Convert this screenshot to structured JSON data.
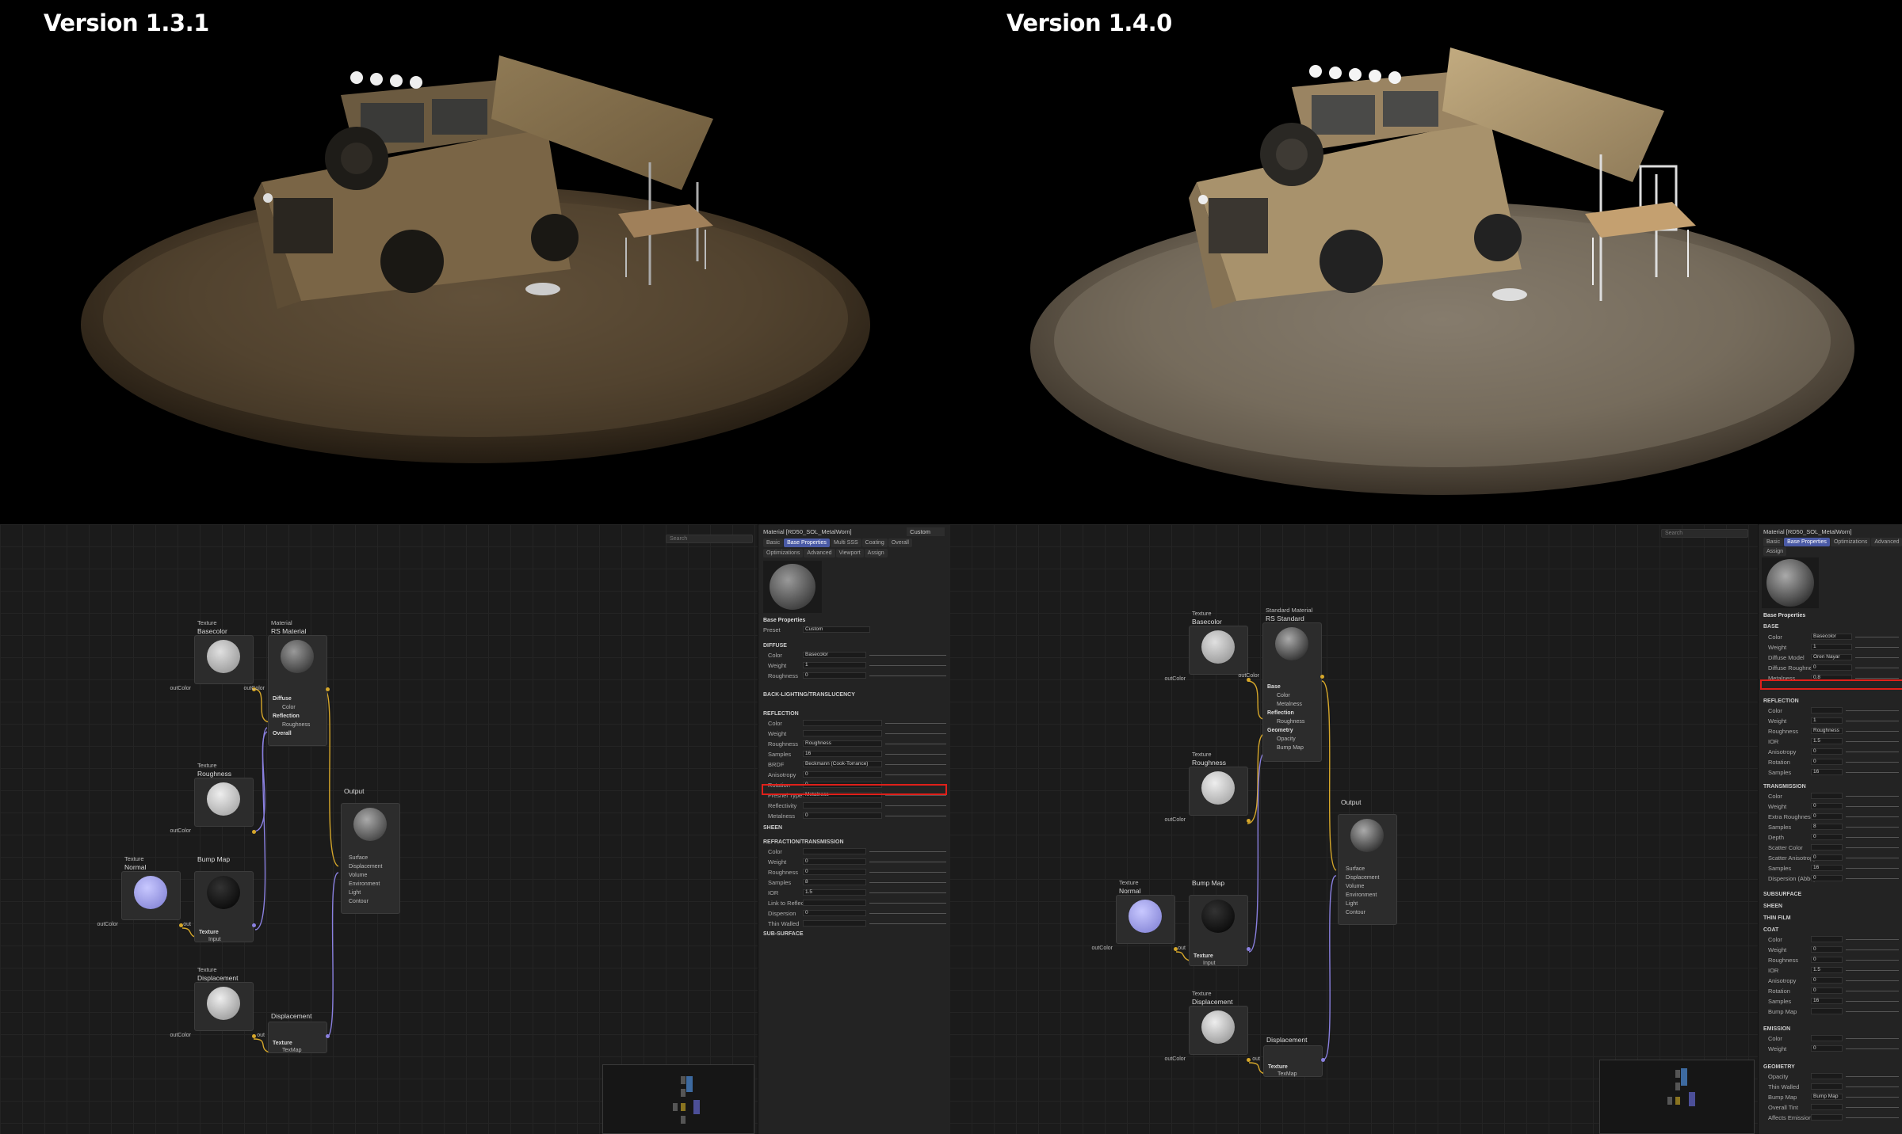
{
  "renders": {
    "left_title": "Version 1.3.1",
    "right_title": "Version 1.4.0"
  },
  "left_editor": {
    "search_placeholder": "Search",
    "nodes": {
      "basecolor": {
        "sup": "Texture",
        "title": "Basecolor",
        "out": "outColor"
      },
      "material": {
        "sup": "Material",
        "title": "RS Material",
        "out": "outColor",
        "inputs": [
          "Diffuse",
          "Color",
          "Reflection",
          "Roughness",
          "Overall"
        ]
      },
      "roughness": {
        "sup": "Texture",
        "title": "Roughness",
        "out": "outColor"
      },
      "output": {
        "title": "Output",
        "inputs": [
          "Surface",
          "Displacement",
          "Volume",
          "Environment",
          "Light",
          "Contour"
        ]
      },
      "normal": {
        "sup": "Texture",
        "title": "Normal",
        "out": "outColor"
      },
      "bumpmap": {
        "title": "Bump Map",
        "out": "out",
        "inputs": [
          "Texture",
          "Input"
        ]
      },
      "displacement_tex": {
        "sup": "Texture",
        "title": "Displacement",
        "out": "outColor"
      },
      "displacement": {
        "title": "Displacement",
        "out": "out",
        "inputs": [
          "Texture",
          "TexMap"
        ]
      }
    }
  },
  "left_panel": {
    "header": "Material [RD50_SOL_MetalWorn]",
    "mode": "Custom",
    "tabs": [
      "Basic",
      "Base Properties",
      "Multi SSS",
      "Coating",
      "Overall"
    ],
    "tabs2": [
      "Optimizations",
      "Advanced",
      "Viewport",
      "Assign"
    ],
    "section_title": "Base Properties",
    "preset_label": "Preset",
    "preset_value": "Custom",
    "diffuse": "DIFFUSE",
    "diffuse_rows": [
      {
        "label": "Color",
        "value": "Basecolor"
      },
      {
        "label": "Weight",
        "value": "1"
      },
      {
        "label": "Roughness",
        "value": "0"
      }
    ],
    "backlighting": "BACK-LIGHTING/TRANSLUCENCY",
    "reflection": "REFLECTION",
    "reflection_rows": [
      {
        "label": "Color",
        "value": ""
      },
      {
        "label": "Weight",
        "value": ""
      },
      {
        "label": "Roughness",
        "value": "Roughness"
      },
      {
        "label": "Samples",
        "value": "16"
      },
      {
        "label": "BRDF",
        "value": "Beckmann (Cook-Torrance)"
      },
      {
        "label": "Anisotropy",
        "value": "0"
      },
      {
        "label": "Rotation",
        "value": "0"
      },
      {
        "label": "Fresnel Type",
        "value": "Metalness"
      },
      {
        "label": "Reflectivity",
        "value": ""
      },
      {
        "label": "Metalness",
        "value": "0"
      }
    ],
    "sheen": "SHEEN",
    "refraction": "REFRACTION/TRANSMISSION",
    "refraction_rows": [
      {
        "label": "Color",
        "value": ""
      },
      {
        "label": "Weight",
        "value": "0"
      },
      {
        "label": "Roughness",
        "value": "0"
      },
      {
        "label": "Samples",
        "value": "8"
      },
      {
        "label": "IOR",
        "value": "1.5"
      },
      {
        "label": "Link to Reflection",
        "value": ""
      },
      {
        "label": "Dispersion",
        "value": "0"
      },
      {
        "label": "Thin Walled",
        "value": ""
      }
    ],
    "subsurface": "SUB-SURFACE"
  },
  "right_editor": {
    "search_placeholder": "Search",
    "nodes": {
      "basecolor": {
        "sup": "Texture",
        "title": "Basecolor",
        "out": "outColor"
      },
      "standard": {
        "sup": "Standard Material",
        "title": "RS Standard",
        "out": "outColor",
        "inputs": [
          "Base",
          "Color",
          "Metalness",
          "Reflection",
          "Roughness",
          "Geometry",
          "Opacity",
          "Bump Map"
        ]
      },
      "roughness": {
        "sup": "Texture",
        "title": "Roughness",
        "out": "outColor"
      },
      "output": {
        "title": "Output",
        "inputs": [
          "Surface",
          "Displacement",
          "Volume",
          "Environment",
          "Light",
          "Contour"
        ]
      },
      "normal": {
        "sup": "Texture",
        "title": "Normal",
        "out": "outColor"
      },
      "bumpmap": {
        "title": "Bump Map",
        "out": "out",
        "inputs": [
          "Texture",
          "Input"
        ]
      },
      "displacement_tex": {
        "sup": "Texture",
        "title": "Displacement",
        "out": "outColor"
      },
      "displacement": {
        "title": "Displacement",
        "out": "out",
        "inputs": [
          "Texture",
          "TexMap"
        ]
      }
    }
  },
  "right_panel": {
    "header": "Material [RD50_SOL_MetalWorn]",
    "tabs": [
      "Basic",
      "Base Properties",
      "Optimizations",
      "Advanced"
    ],
    "tabs2": [
      "Assign"
    ],
    "section_title": "Base Properties",
    "base": "BASE",
    "base_rows": [
      {
        "label": "Color",
        "value": "Basecolor"
      },
      {
        "label": "Weight",
        "value": "1"
      },
      {
        "label": "Diffuse Model",
        "value": "Oren Nayar"
      },
      {
        "label": "Diffuse Roughness",
        "value": "0"
      },
      {
        "label": "Metalness",
        "value": "0.8"
      }
    ],
    "reflection": "REFLECTION",
    "reflection_rows": [
      {
        "label": "Color",
        "value": ""
      },
      {
        "label": "Weight",
        "value": "1"
      },
      {
        "label": "Roughness",
        "value": "Roughness"
      },
      {
        "label": "IOR",
        "value": "1.5"
      },
      {
        "label": "Anisotropy",
        "value": "0"
      },
      {
        "label": "Rotation",
        "value": "0"
      },
      {
        "label": "Samples",
        "value": "16"
      }
    ],
    "transmission": "TRANSMISSION",
    "transmission_rows": [
      {
        "label": "Color",
        "value": ""
      },
      {
        "label": "Weight",
        "value": "0"
      },
      {
        "label": "Extra Roughness",
        "value": "0"
      },
      {
        "label": "Samples",
        "value": "8"
      },
      {
        "label": "Depth",
        "value": "0"
      },
      {
        "label": "Scatter Color",
        "value": ""
      },
      {
        "label": "Scatter Anisotropy",
        "value": "0"
      },
      {
        "label": "Samples",
        "value": "16"
      },
      {
        "label": "Dispersion (Abbe)",
        "value": "0"
      }
    ],
    "subsurface": "SUBSURFACE",
    "sheen": "SHEEN",
    "thinfilm": "THIN FILM",
    "coat": "COAT",
    "coat_rows": [
      {
        "label": "Color",
        "value": ""
      },
      {
        "label": "Weight",
        "value": "0"
      },
      {
        "label": "Roughness",
        "value": "0"
      },
      {
        "label": "IOR",
        "value": "1.5"
      },
      {
        "label": "Anisotropy",
        "value": "0"
      },
      {
        "label": "Rotation",
        "value": "0"
      },
      {
        "label": "Samples",
        "value": "16"
      },
      {
        "label": "Bump Map",
        "value": ""
      }
    ],
    "emission": "EMISSION",
    "emission_rows": [
      {
        "label": "Color",
        "value": ""
      },
      {
        "label": "Weight",
        "value": "0"
      }
    ],
    "geometry": "GEOMETRY",
    "geometry_rows": [
      {
        "label": "Opacity",
        "value": ""
      },
      {
        "label": "Thin Walled",
        "value": ""
      },
      {
        "label": "Bump Map",
        "value": "Bump Map"
      },
      {
        "label": "Overall Tint",
        "value": ""
      },
      {
        "label": "Affects Emission",
        "value": ""
      }
    ]
  },
  "colors": {
    "material_bar": "#3d86c6",
    "output_bar": "#5b60c8",
    "texture_bar": "#3a3a3a",
    "bump_bar": "#b99a2a",
    "socket_yellow": "#d6a72a",
    "socket_purple": "#8a80e0",
    "highlight": "#e0201a"
  }
}
